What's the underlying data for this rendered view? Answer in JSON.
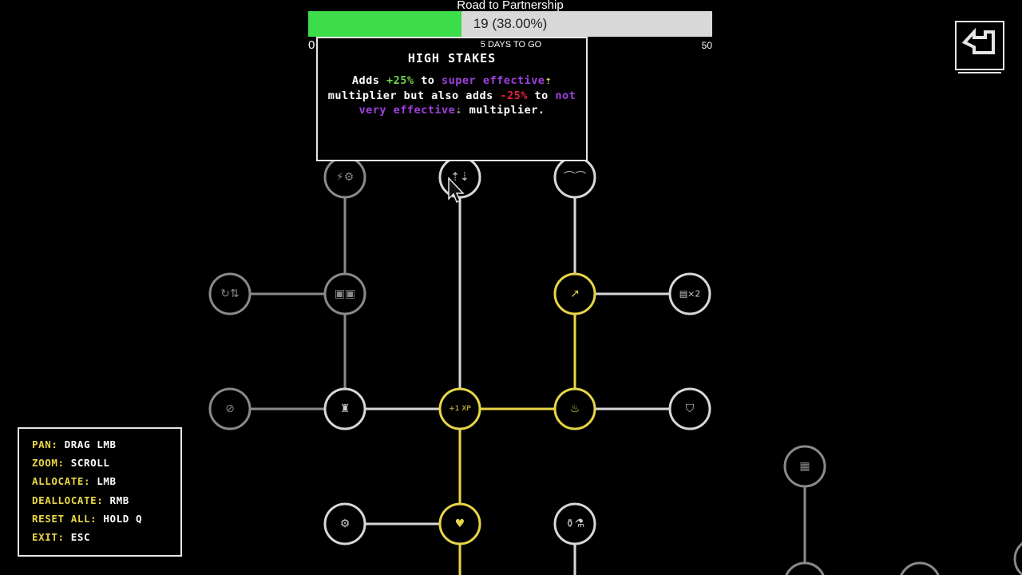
{
  "progress": {
    "title": "Road to Partnership",
    "value_text": "19 (38.00%)",
    "fraction": 0.38,
    "min_label": "0",
    "max_label": "50",
    "days_left": "5 DAYS TO GO"
  },
  "tooltip": {
    "title": "HIGH STAKES",
    "seg_adds": "Adds ",
    "seg_plus": "+25%",
    "seg_to1": " to ",
    "seg_super": "super effective",
    "seg_up_arrow": "⇡",
    "seg_mid": " multiplier but also adds ",
    "seg_minus": "-25%",
    "seg_to2": " to ",
    "seg_not": "not very effective",
    "seg_down_arrow": "⇣",
    "seg_end": " multiplier."
  },
  "controls": [
    {
      "key": "PAN:",
      "value": "DRAG LMB"
    },
    {
      "key": "ZOOM:",
      "value": "SCROLL"
    },
    {
      "key": "ALLOCATE:",
      "value": "LMB"
    },
    {
      "key": "DEALLOCATE:",
      "value": "RMB"
    },
    {
      "key": "RESET ALL:",
      "value": "HOLD Q"
    },
    {
      "key": "EXIT:",
      "value": "ESC"
    }
  ],
  "back_button": {
    "icon": "back-arrow-icon"
  },
  "colors": {
    "accent_gold": "#e8d648",
    "progress_green": "#3ddc4a",
    "positive": "#6ed64a",
    "negative": "#e0203a",
    "effective_purple": "#a040e0"
  },
  "nodes": [
    {
      "id": "n-strength-defense",
      "state": "locked",
      "icon": "bolt-shield-icon",
      "glyph": "⚡⚙"
    },
    {
      "id": "n-high-stakes",
      "state": "available",
      "icon": "up-down-arrows-icon",
      "glyph": "⇡⇣"
    },
    {
      "id": "n-glasses",
      "state": "available",
      "icon": "glasses-icon",
      "glyph": "⌒⌒"
    },
    {
      "id": "n-swap",
      "state": "locked",
      "icon": "swap-icon",
      "glyph": "↻⇅"
    },
    {
      "id": "n-boxes",
      "state": "locked",
      "icon": "boxes-icon",
      "glyph": "▣▣"
    },
    {
      "id": "n-chart",
      "state": "allocated",
      "icon": "chart-icon",
      "glyph": "↗"
    },
    {
      "id": "n-double",
      "state": "available",
      "icon": "double-icon",
      "glyph": "▤×2"
    },
    {
      "id": "n-no-target",
      "state": "locked",
      "icon": "no-target-icon",
      "glyph": "⊘"
    },
    {
      "id": "n-tower",
      "state": "available",
      "icon": "tower-icon",
      "glyph": "♜"
    },
    {
      "id": "n-xp",
      "state": "allocated",
      "icon": "xp-icon",
      "glyph": "+1 XP"
    },
    {
      "id": "n-pot",
      "state": "allocated",
      "icon": "pot-icon",
      "glyph": "♨"
    },
    {
      "id": "n-shield-split",
      "state": "available",
      "icon": "split-shield-icon",
      "glyph": "⛉"
    },
    {
      "id": "n-gear-bird",
      "state": "available",
      "icon": "gear-bird-icon",
      "glyph": "⚙"
    },
    {
      "id": "n-heart",
      "state": "allocated",
      "icon": "heart-icon",
      "glyph": "♥"
    },
    {
      "id": "n-potions",
      "state": "available",
      "icon": "potions-icon",
      "glyph": "⚱⚗"
    },
    {
      "id": "n-calendar",
      "state": "locked",
      "icon": "calendar-icon",
      "glyph": "▦"
    }
  ]
}
